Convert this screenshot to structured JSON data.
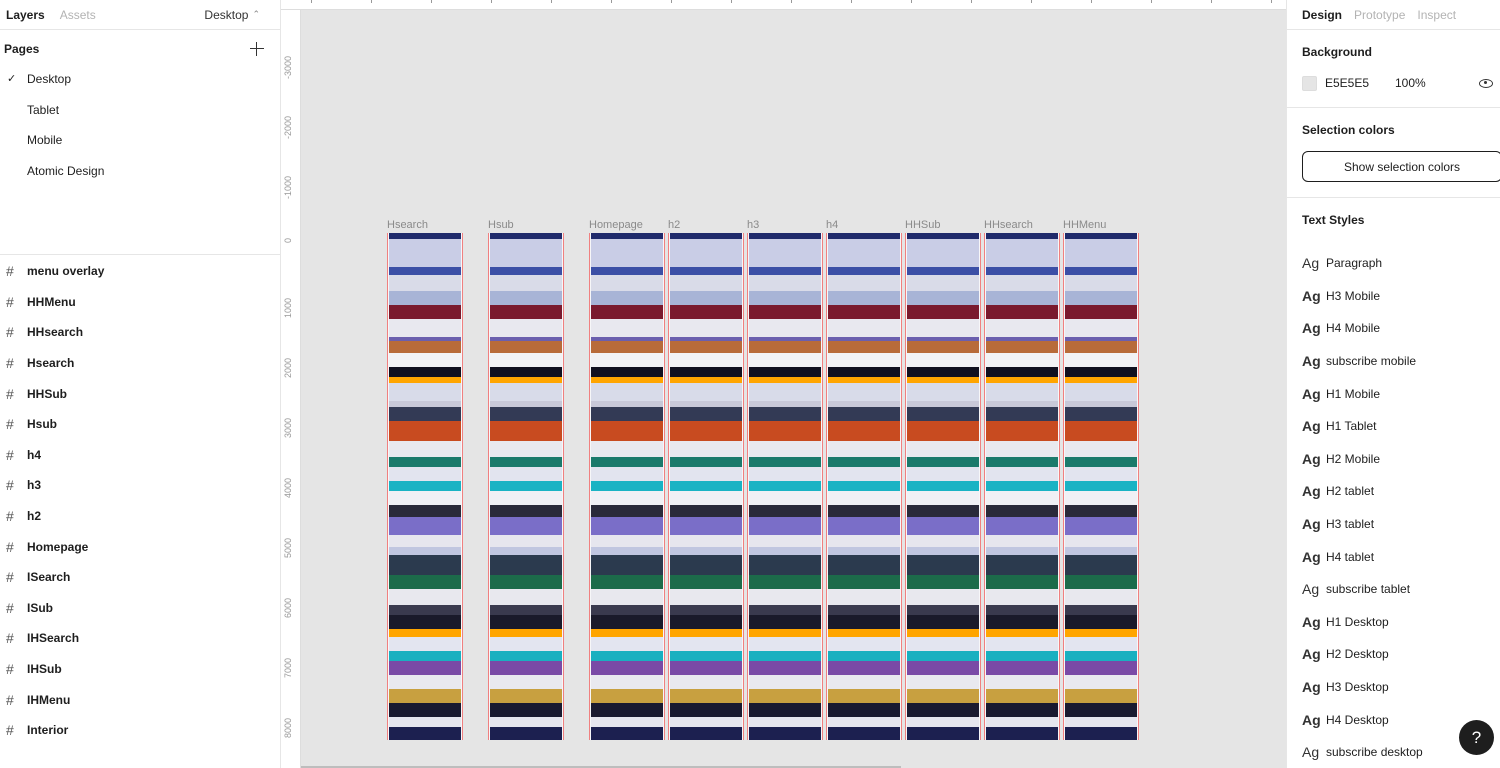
{
  "left_panel": {
    "tab_layers": "Layers",
    "tab_assets": "Assets",
    "current_page": "Desktop",
    "pages_title": "Pages",
    "pages": [
      {
        "label": "Desktop",
        "selected": true
      },
      {
        "label": "Tablet",
        "selected": false
      },
      {
        "label": "Mobile",
        "selected": false
      },
      {
        "label": "Atomic Design",
        "selected": false
      }
    ],
    "layers": [
      "menu overlay",
      "HHMenu",
      "HHsearch",
      "Hsearch",
      "HHSub",
      "Hsub",
      "h4",
      "h3",
      "h2",
      "Homepage",
      "ISearch",
      "ISub",
      "IHSearch",
      "IHSub",
      "IHMenu",
      "Interior"
    ]
  },
  "canvas": {
    "background": "#E5E5E5",
    "ruler_left_labels": [
      "-3000",
      "-2000",
      "-1000",
      "0",
      "1000",
      "2000",
      "3000",
      "4000",
      "5000",
      "6000",
      "7000",
      "8000"
    ],
    "frames": [
      "Hsearch",
      "Hsub",
      "Homepage",
      "h2",
      "h3",
      "h4",
      "HHSub",
      "HHsearch",
      "HHMenu"
    ]
  },
  "right_panel": {
    "tab_design": "Design",
    "tab_prototype": "Prototype",
    "tab_inspect": "Inspect",
    "background_title": "Background",
    "background_hex": "E5E5E5",
    "background_opacity": "100%",
    "selection_colors_title": "Selection colors",
    "show_selection_colors": "Show selection colors",
    "text_styles_title": "Text Styles",
    "text_styles": [
      {
        "glyph": "Ag",
        "name": "Paragraph",
        "bold": false
      },
      {
        "glyph": "Ag",
        "name": "H3 Mobile",
        "bold": true
      },
      {
        "glyph": "Ag",
        "name": "H4 Mobile",
        "bold": true
      },
      {
        "glyph": "Ag",
        "name": "subscribe mobile",
        "bold": true
      },
      {
        "glyph": "Ag",
        "name": "H1 Mobile",
        "bold": true
      },
      {
        "glyph": "Ag",
        "name": "H1 Tablet",
        "bold": true
      },
      {
        "glyph": "Ag",
        "name": "H2 Mobile",
        "bold": true
      },
      {
        "glyph": "Ag",
        "name": "H2 tablet",
        "bold": true
      },
      {
        "glyph": "Ag",
        "name": "H3 tablet",
        "bold": true
      },
      {
        "glyph": "Ag",
        "name": "H4 tablet",
        "bold": true
      },
      {
        "glyph": "Ag",
        "name": "subscribe tablet",
        "bold": false
      },
      {
        "glyph": "Ag",
        "name": "H1 Desktop",
        "bold": true
      },
      {
        "glyph": "Ag",
        "name": "H2 Desktop",
        "bold": true
      },
      {
        "glyph": "Ag",
        "name": "H3 Desktop",
        "bold": true
      },
      {
        "glyph": "Ag",
        "name": "H4 Desktop",
        "bold": true
      },
      {
        "glyph": "Ag",
        "name": "subscribe desktop",
        "bold": false
      }
    ]
  },
  "help_button_label": "?"
}
